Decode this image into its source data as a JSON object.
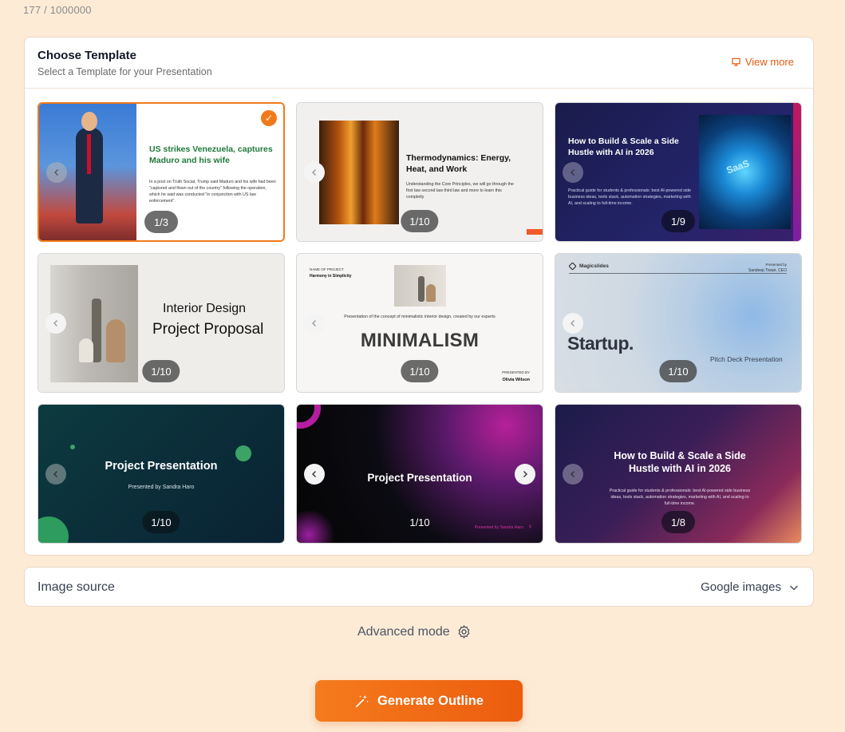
{
  "counter": "177 / 1000000",
  "template_panel": {
    "title": "Choose Template",
    "subtitle": "Select a Template for your Presentation",
    "view_more": "View more"
  },
  "templates": [
    {
      "badge": "1/3",
      "selected": true,
      "title": "US strikes Venezuela, captures Maduro and his wife",
      "body": "In a post on Truth Social, Trump said Maduro and his wife had been \"captured and flown out of the country\" following the operation, which he said was conducted \"in conjunction with US law enforcement\"."
    },
    {
      "badge": "1/10",
      "title": "Thermodynamics: Energy, Heat, and Work",
      "body": "Understanding the Core Principles, we will go through the first law second law third law and more to learn this completly"
    },
    {
      "badge": "1/9",
      "title": "How to Build & Scale a Side Hustle with AI in 2026",
      "body": "Practical guide for students & professionals: best AI-powered side business ideas, tools stack, automation strategies, marketing with AI, and scaling to full-time income.",
      "image_text": "SaaS"
    },
    {
      "badge": "1/10",
      "title_small": "Interior Design",
      "title": "Project Proposal"
    },
    {
      "badge": "1/10",
      "name_label": "NAME OF PROJECT",
      "name": "Harmony in Simplicity",
      "caption": "Presentation of the concept of minimalistic interior design, created by our experts",
      "title": "MINIMALISM",
      "presented_label": "PRESENTED BY",
      "presenter": "Olivia Wilson"
    },
    {
      "badge": "1/10",
      "brand": "Magicslides",
      "presented": "Presented by",
      "presenter": "Sandeep Tiwari, CEO",
      "title": "Startup.",
      "subtitle": "Pitch Deck Presentation"
    },
    {
      "badge": "1/10",
      "title": "Project Presentation",
      "subtitle": "Presented by Sandra Haro"
    },
    {
      "badge": "1/10",
      "title": "Project Presentation",
      "footer": "Presented by Sandra Haro"
    },
    {
      "badge": "1/8",
      "title": "How to Build & Scale a Side Hustle with AI in 2026",
      "body": "Practical guide for students & professionals: best AI-powered side business ideas, tools stack, automation strategies, marketing with AI, and scaling to full-time income."
    }
  ],
  "image_source": {
    "label": "Image source",
    "value": "Google images"
  },
  "advanced_mode": "Advanced mode",
  "generate_button": "Generate Outline",
  "colors": {
    "accent": "#f27a1a",
    "background": "#fdebd6"
  }
}
